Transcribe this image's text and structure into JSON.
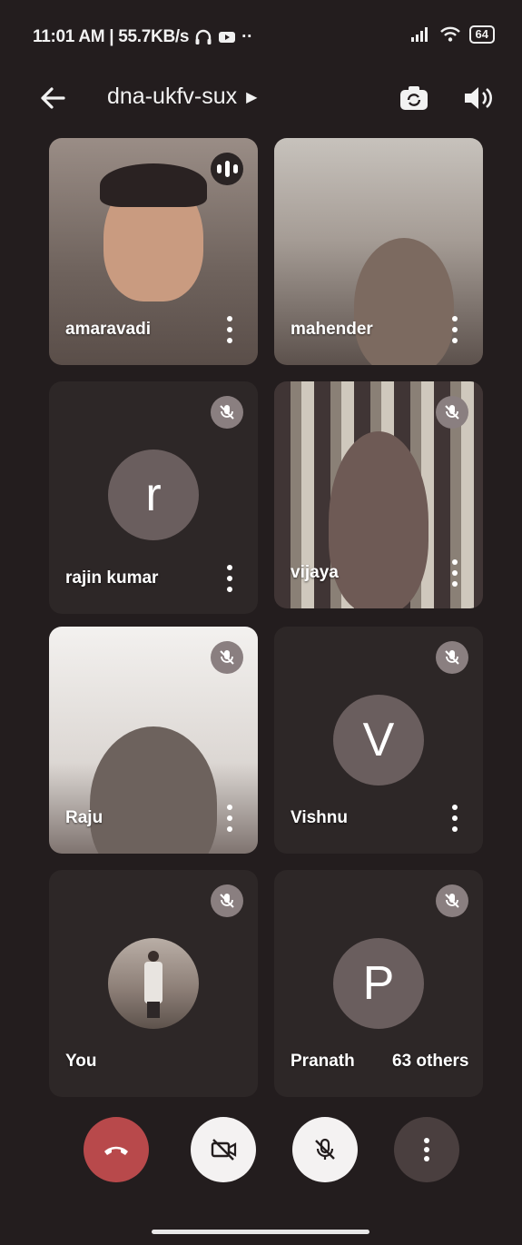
{
  "status_bar": {
    "time_info": "11:01 AM | 55.7KB/s",
    "battery": "64"
  },
  "meeting": {
    "code": "dna-ukfv-sux"
  },
  "participants": [
    {
      "name": "amaravadi",
      "video": true,
      "muted": false,
      "speaking": true
    },
    {
      "name": "mahender",
      "video": true,
      "muted": false,
      "speaking": false
    },
    {
      "name": "rajin kumar",
      "initial": "r",
      "video": false,
      "muted": true
    },
    {
      "name": "vijaya",
      "video": true,
      "muted": true
    },
    {
      "name": "Raju",
      "video": true,
      "muted": true
    },
    {
      "name": "Vishnu",
      "initial": "V",
      "video": false,
      "muted": true
    },
    {
      "name": "You",
      "video": false,
      "muted": true
    },
    {
      "name": "Pranath",
      "initial": "P",
      "video": false,
      "muted": true
    }
  ],
  "others_label": "63 others",
  "icons": {
    "back": "arrow-left-icon",
    "camera_switch": "camera-switch-icon",
    "speaker": "speaker-icon",
    "mic_off": "mic-off-icon",
    "end_call": "phone-hangup-icon",
    "video_off": "video-off-icon",
    "more": "more-vertical-icon"
  },
  "colors": {
    "background": "#231d1e",
    "end_call": "#b8494b",
    "control_light": "#f4f2f2"
  }
}
